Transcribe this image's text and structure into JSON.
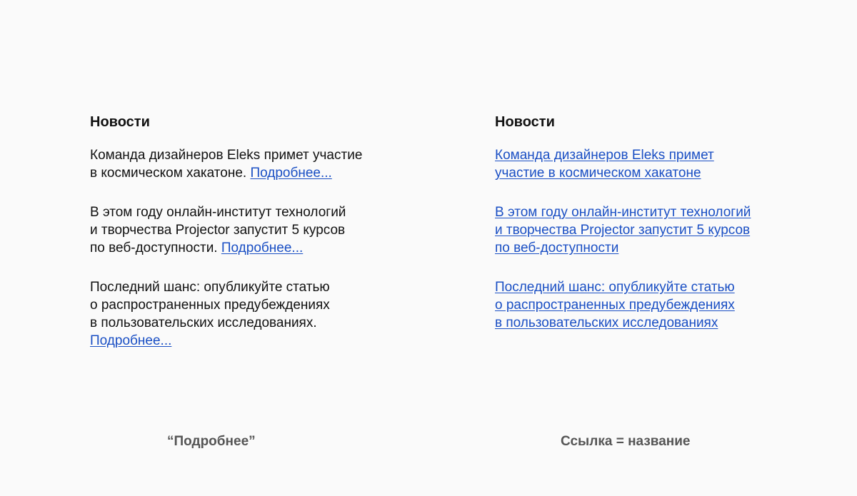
{
  "left": {
    "heading": "Новости",
    "items": [
      {
        "lines": [
          "Команда дизайнеров Eleks примет участие",
          "в космическом хакатоне."
        ],
        "link": "Подробнее..."
      },
      {
        "lines": [
          "В этом году онлайн-институт технологий",
          "и творчества Projector запустит 5 курсов",
          "по веб-доступности."
        ],
        "link": "Подробнее..."
      },
      {
        "lines": [
          "Последний шанс: опубликуйте статью",
          "о распространенных предубеждениях",
          "в пользовательских исследованиях."
        ],
        "link": "Подробнее..."
      }
    ],
    "caption": "“Подробнее”"
  },
  "right": {
    "heading": "Новости",
    "items": [
      {
        "lines": [
          "Команда дизайнеров Eleks примет",
          "участие в космическом хакатоне"
        ]
      },
      {
        "lines": [
          "В этом году онлайн-институт технологий",
          "и творчества Projector запустит 5 курсов",
          "по веб-доступности"
        ]
      },
      {
        "lines": [
          "Последний шанс: опубликуйте статью",
          "о распространенных предубеждениях",
          "в пользовательских исследованиях"
        ]
      }
    ],
    "caption": "Ссылка = название"
  },
  "colors": {
    "link": "#1a4fc4",
    "text": "#111111",
    "caption": "#555555",
    "background": "#fafafa"
  }
}
